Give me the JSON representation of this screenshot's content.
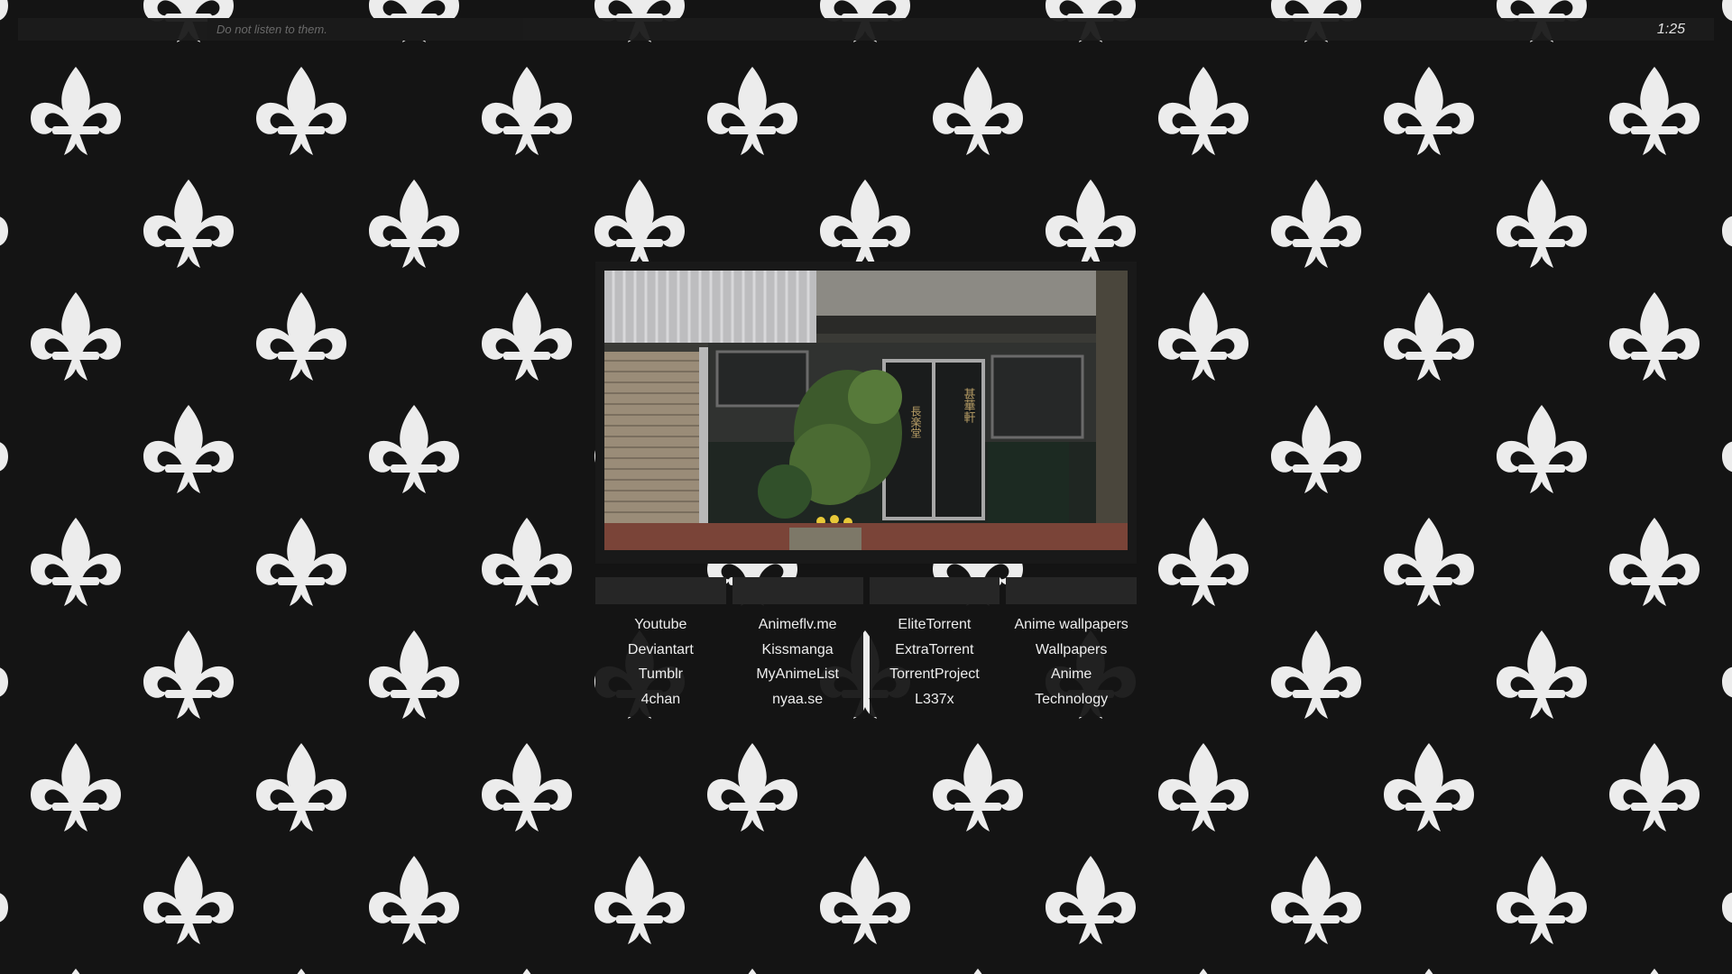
{
  "search": {
    "placeholder": "Do not listen to them."
  },
  "clock": "1:25",
  "background": {
    "pattern_icon": "fleur-de-lis-icon",
    "colors": {
      "bg": "#141414",
      "motif": "#ececec"
    }
  },
  "photo": {
    "subject": "storefront-photo",
    "hanzi_1": "長楽堂",
    "hanzi_2": "甚華軒"
  },
  "link_columns": [
    {
      "links": [
        "Youtube",
        "Deviantart",
        "Tumblr",
        "4chan"
      ]
    },
    {
      "links": [
        "Animeflv.me",
        "Kissmanga",
        "MyAnimeList",
        "nyaa.se"
      ]
    },
    {
      "links": [
        "EliteTorrent",
        "ExtraTorrent",
        "TorrentProject",
        "L337x"
      ]
    },
    {
      "links": [
        "Anime wallpapers",
        "Wallpapers",
        "Anime",
        "Technology"
      ]
    }
  ]
}
